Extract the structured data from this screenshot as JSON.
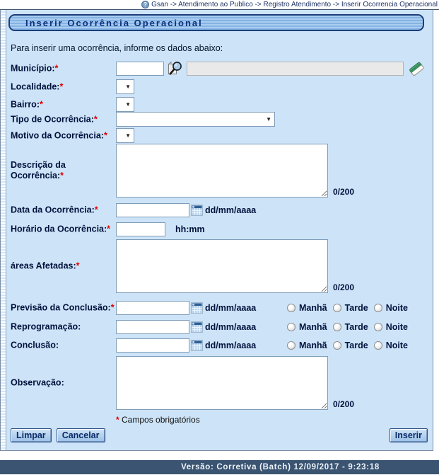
{
  "breadcrumb": {
    "path": "Gsan -> Atendimento ao Publico -> Registro Atendimento -> Inserir Ocorrencia Operacional",
    "help_icon": "question-mark-circle-icon"
  },
  "page": {
    "title": "Inserir Ocorrência Operacional",
    "intro": "Para inserir uma ocorrência, informe os dados abaixo:"
  },
  "icons": {
    "select_arrow": "▼",
    "search": "magnifier-over-document",
    "erase": "eraser",
    "calendar": "calendar-grid"
  },
  "form": {
    "municipio": {
      "label": "Município:",
      "required": "*",
      "value": "",
      "name_display": ""
    },
    "localidade": {
      "label": "Localidade:",
      "required": "*",
      "selected": ""
    },
    "bairro": {
      "label": "Bairro:",
      "required": "*",
      "selected": ""
    },
    "tipo_ocorrencia": {
      "label": "Tipo de Ocorrência:",
      "required": "*",
      "selected": ""
    },
    "motivo_ocorrencia": {
      "label": "Motivo da Ocorrência:",
      "required": "*",
      "selected": ""
    },
    "descricao": {
      "label": "Descrição da Ocorrência:",
      "required": "*",
      "value": "",
      "counter": "0/200"
    },
    "data_ocorrencia": {
      "label": "Data da Ocorrência:",
      "required": "*",
      "value": "",
      "format_hint": "dd/mm/aaaa"
    },
    "horario_ocorrencia": {
      "label": "Horário da Ocorrência:",
      "required": "*",
      "value": "",
      "format_hint": "hh:mm"
    },
    "areas_afetadas": {
      "label": "áreas Afetadas:",
      "required": "*",
      "value": "",
      "counter": "0/200"
    },
    "previsao_conclusao": {
      "label": "Previsão da Conclusão:",
      "required": "*",
      "value": "",
      "format_hint": "dd/mm/aaaa"
    },
    "reprogramacao": {
      "label": "Reprogramação:",
      "value": "",
      "format_hint": "dd/mm/aaaa"
    },
    "conclusao": {
      "label": "Conclusão:",
      "value": "",
      "format_hint": "dd/mm/aaaa"
    },
    "observacao": {
      "label": "Observação:",
      "value": "",
      "counter": "0/200"
    },
    "periods": [
      "Manhã",
      "Tarde",
      "Noite"
    ],
    "required_note_marker": "*",
    "required_note_text": "Campos obrigatórios"
  },
  "buttons": {
    "limpar": "Limpar",
    "cancelar": "Cancelar",
    "inserir": "Inserir"
  },
  "footer": {
    "version_text": "Versão: Corretiva (Batch) 12/09/2017 - 9:23:18"
  },
  "colors": {
    "content_bg": "#cde3f7",
    "title_text": "#0e2f7a",
    "label_text": "#00123d",
    "required": "#e00000",
    "footer_bg": "#3a5471",
    "footer_text": "#eef3f9"
  }
}
